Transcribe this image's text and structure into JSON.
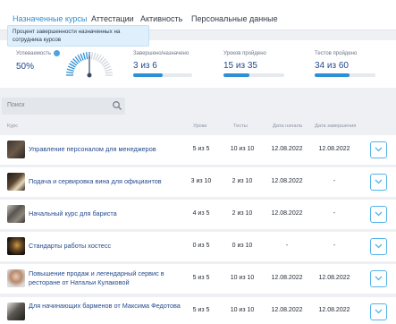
{
  "tabs": [
    {
      "label": "Назначенные курсы",
      "active": true
    },
    {
      "label": "Аттестации",
      "active": false
    },
    {
      "label": "Активность",
      "active": false
    },
    {
      "label": "Персональные данные",
      "active": false
    }
  ],
  "tooltip": "Процент завершенности назначенных на сотрудника курсов",
  "stats": {
    "success": {
      "label": "Успеваемость",
      "value": "50%",
      "gauge_fraction": 0.5
    },
    "completed": {
      "label": "Завершено/назначено",
      "value": "3 из 6",
      "fraction": 0.5
    },
    "lessons": {
      "label": "Уроков пройдено",
      "value": "15 из 35",
      "fraction": 0.43
    },
    "tests": {
      "label": "Тестов пройдено",
      "value": "34 из 60",
      "fraction": 0.57
    }
  },
  "search": {
    "placeholder": "Поиск"
  },
  "table": {
    "headers": {
      "course": "Курс",
      "lessons": "Уроки",
      "tests": "Тесты",
      "start": "Дата начала",
      "end": "Дата завершения"
    },
    "rows": [
      {
        "title": "Управление персоналом для менеджеров",
        "lessons": "5 из 5",
        "tests": "10 из 10",
        "start": "12.08.2022",
        "end": "12.08.2022"
      },
      {
        "title": "Подача и сервировка вина для официантов",
        "lessons": "3 из 10",
        "tests": "2 из 10",
        "start": "12.08.2022",
        "end": "-"
      },
      {
        "title": "Начальный курс для бариста",
        "lessons": "4 из 5",
        "tests": "2 из 10",
        "start": "12.08.2022",
        "end": "-"
      },
      {
        "title": "Стандарты работы хостесс",
        "lessons": "0 из 5",
        "tests": "0 из 10",
        "start": "-",
        "end": "-"
      },
      {
        "title": "Повышение продаж и легендарный сервис в ресторане от Натальи Кулаковой",
        "lessons": "5 из 5",
        "tests": "10 из 10",
        "start": "12.08.2022",
        "end": "12.08.2022"
      },
      {
        "title": "Для начинающих барменов от Максима Федотова",
        "lessons": "5 из 5",
        "tests": "10 из 10",
        "start": "12.08.2022",
        "end": "12.08.2022"
      }
    ]
  },
  "colors": {
    "accent": "#2d8fd5",
    "link": "#234a8c",
    "tooltip_bg": "#dff0fc"
  },
  "icons": {
    "search": "search-icon",
    "expand": "chevron-down-icon",
    "info": "info-icon"
  }
}
